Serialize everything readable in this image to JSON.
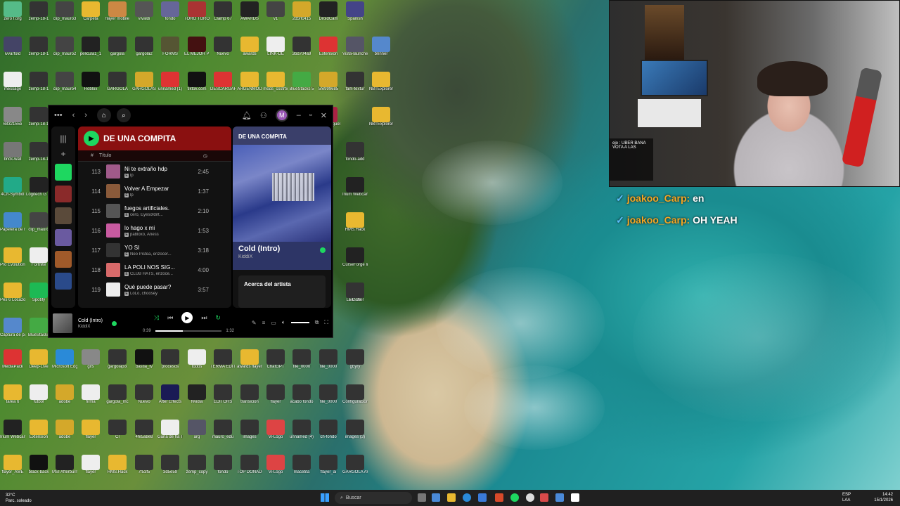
{
  "desktop": {
    "icons": [
      {
        "label": "zero f.org",
        "color": "#5b8"
      },
      {
        "label": "zemp-18-1",
        "color": "#333"
      },
      {
        "label": "clip_mauro3",
        "color": "#444"
      },
      {
        "label": "Carpeta",
        "color": "#e8b830"
      },
      {
        "label": "flayer mobile",
        "color": "#c84"
      },
      {
        "label": "vivaldi",
        "color": "#555"
      },
      {
        "label": "fondo",
        "color": "#669"
      },
      {
        "label": "TORO TORO",
        "color": "#a33"
      },
      {
        "label": "Clamp 67",
        "color": "#333"
      },
      {
        "label": "AWARDS",
        "color": "#222"
      },
      {
        "label": "v1",
        "color": "#444"
      },
      {
        "label": "2d5ffc415",
        "color": "#d4a82a"
      },
      {
        "label": "DroidCam",
        "color": "#222"
      },
      {
        "label": "Spanish",
        "color": "#448"
      },
      {
        "label": "ivvarfold",
        "color": "#446"
      },
      {
        "label": "zemp-18-1",
        "color": "#333"
      },
      {
        "label": "clip_mauro2",
        "color": "#444"
      },
      {
        "label": "pelicula1_1",
        "color": "#222"
      },
      {
        "label": "gargola",
        "color": "#333"
      },
      {
        "label": "gargola2",
        "color": "#333"
      },
      {
        "label": "FORMS",
        "color": "#553"
      },
      {
        "label": "EL MEJOR PHONK",
        "color": "#411"
      },
      {
        "label": "Nuevo",
        "color": "#333"
      },
      {
        "label": "awards",
        "color": "#e8b830"
      },
      {
        "label": "LINK-DE",
        "color": "#eee"
      },
      {
        "label": "3bd704a9",
        "color": "#333"
      },
      {
        "label": "Extension",
        "color": "#d33"
      },
      {
        "label": "Vista-launcher",
        "color": "#556"
      },
      {
        "label": "brinner",
        "color": "#58c"
      },
      {
        "label": "message",
        "color": "#eee"
      },
      {
        "label": "zemp-18-1",
        "color": "#333"
      },
      {
        "label": "clip_mauro4",
        "color": "#444"
      },
      {
        "label": "Roblox",
        "color": "#111"
      },
      {
        "label": "GARGOLA",
        "color": "#333"
      },
      {
        "label": "GARGOLAS",
        "color": "#d4a82a"
      },
      {
        "label": "unnamed (1)",
        "color": "#d33"
      },
      {
        "label": "tiktok.com",
        "color": "#111"
      },
      {
        "label": "DESCARGAR",
        "color": "#d33"
      },
      {
        "label": "ARGENMOD",
        "color": "#e8b830"
      },
      {
        "label": "mods_csstrtx",
        "color": "#e8b830"
      },
      {
        "label": "BlueStacks 5",
        "color": "#4a4"
      },
      {
        "label": "5fe999685",
        "color": "#d4a82a"
      },
      {
        "label": "fam-textur",
        "color": "#333"
      },
      {
        "label": "NBTExplorer",
        "color": "#e8b830"
      },
      {
        "label": "6832155e",
        "color": "#888"
      },
      {
        "label": "zemp-18-1",
        "color": "#333"
      },
      {
        "label": "brick-wall",
        "color": "#777"
      },
      {
        "label": "zemp-18-1",
        "color": "#333"
      },
      {
        "label": "4Ch-Symbol",
        "color": "#2a8"
      },
      {
        "label": "Logitech G HUB",
        "color": "#222"
      },
      {
        "label": "Papelera de reciclaje",
        "color": "#48c"
      },
      {
        "label": "clip_mauro",
        "color": "#444"
      },
      {
        "label": "Pro Evolution Soccer 6",
        "color": "#e8b830"
      },
      {
        "label": "Fortnite",
        "color": "#eee"
      },
      {
        "label": "Pes 6 Locazos",
        "color": "#e8b830"
      },
      {
        "label": "Spotify",
        "color": "#1db954"
      },
      {
        "label": "Captura de pantalla",
        "color": "#58c"
      },
      {
        "label": "BlueStacks",
        "color": "#4a4"
      },
      {
        "label": "flayer miguel",
        "color": "#a24"
      },
      {
        "label": "NBTExplorer",
        "color": "#e8b830"
      },
      {
        "label": "fondo-add",
        "color": "#333"
      },
      {
        "label": "Irium Webcam",
        "color": "#222"
      },
      {
        "label": "HMS.Hack",
        "color": "#e8b830"
      },
      {
        "label": "CurseForge Installer",
        "color": "#222"
      },
      {
        "label": "Launcher",
        "color": "#333"
      },
      {
        "label": "FC 26",
        "color": "#333"
      },
      {
        "label": "MediaPack",
        "color": "#d33"
      },
      {
        "label": "Deep-Live",
        "color": "#e8b830"
      },
      {
        "label": "Microsoft Edge",
        "color": "#2a8ad8"
      },
      {
        "label": "gifs",
        "color": "#888"
      },
      {
        "label": "gargolapix",
        "color": "#333"
      },
      {
        "label": "bastia_tv",
        "color": "#111"
      },
      {
        "label": "procesos",
        "color": "#333"
      },
      {
        "label": "todos",
        "color": "#eee"
      },
      {
        "label": "TERMA EDITOR",
        "color": "#333"
      },
      {
        "label": "awards flayer",
        "color": "#e8b830"
      },
      {
        "label": "ChatGPT",
        "color": "#333"
      },
      {
        "label": "file_0000",
        "color": "#333"
      },
      {
        "label": "file_0000",
        "color": "#333"
      },
      {
        "label": "gbyry",
        "color": "#333"
      },
      {
        "label": "tarea 6",
        "color": "#e8b830"
      },
      {
        "label": "futbol",
        "color": "#eee"
      },
      {
        "label": "adobe",
        "color": "#d4a82a"
      },
      {
        "label": "firma",
        "color": "#eee"
      },
      {
        "label": "gargola_mc",
        "color": "#333"
      },
      {
        "label": "Nuevo",
        "color": "#333"
      },
      {
        "label": "After Effects",
        "color": "#1a1a55"
      },
      {
        "label": "Nvidia",
        "color": "#222"
      },
      {
        "label": "EDITORS",
        "color": "#333"
      },
      {
        "label": "transicion",
        "color": "#333"
      },
      {
        "label": "flayer",
        "color": "#333"
      },
      {
        "label": "acabo fondo",
        "color": "#333"
      },
      {
        "label": "file_0000",
        "color": "#333"
      },
      {
        "label": "Configuracion",
        "color": "#333"
      },
      {
        "label": "Irium Webcam",
        "color": "#222"
      },
      {
        "label": "Extension",
        "color": "#e8b830"
      },
      {
        "label": "adobe",
        "color": "#d4a82a"
      },
      {
        "label": "flayer",
        "color": "#e8b830"
      },
      {
        "label": "CI",
        "color": "#333"
      },
      {
        "label": "4fe5a8e8",
        "color": "#333"
      },
      {
        "label": "Gana de ha Touch",
        "color": "#eee"
      },
      {
        "label": "arg",
        "color": "#556"
      },
      {
        "label": "mauro_edu",
        "color": "#333"
      },
      {
        "label": "images",
        "color": "#333"
      },
      {
        "label": "Vi-Logo",
        "color": "#d44"
      },
      {
        "label": "unnamed (4)",
        "color": "#333"
      },
      {
        "label": "ch-fondo",
        "color": "#333"
      },
      {
        "label": "images (3)",
        "color": "#333"
      },
      {
        "label": "flayer_AME",
        "color": "#e8b830"
      },
      {
        "label": "black-back",
        "color": "#111"
      },
      {
        "label": "MSI Afterburner",
        "color": "#222"
      },
      {
        "label": "flayer",
        "color": "#eee"
      },
      {
        "label": "HMS.Hack",
        "color": "#e8b830"
      },
      {
        "label": "7f53f5",
        "color": "#333"
      },
      {
        "label": "3d5e59",
        "color": "#333"
      },
      {
        "label": "zemp_copy",
        "color": "#333"
      },
      {
        "label": "fondo",
        "color": "#333"
      },
      {
        "label": "TOP DONADOR",
        "color": "#333"
      },
      {
        "label": "Vi-Logo",
        "color": "#d44"
      },
      {
        "label": "macetita",
        "color": "#333"
      },
      {
        "label": "flayer_ai",
        "color": "#333"
      },
      {
        "label": "GARGOLA AWARDS",
        "color": "#333"
      }
    ]
  },
  "spotify": {
    "playlist_title": "DE UNA COMPITA",
    "column_title": "Título",
    "tracks": [
      {
        "num": "113",
        "name": "Ni te extraño hdp",
        "artist": "lp",
        "duration": "2:45",
        "art": "#a05a8a"
      },
      {
        "num": "114",
        "name": "Volver A Empezar",
        "artist": "lp",
        "duration": "1:37",
        "art": "#8a5a3a"
      },
      {
        "num": "115",
        "name": "fuegos artificiales.",
        "artist": "cero, Eyesofdirt...",
        "duration": "2:10",
        "art": "#555"
      },
      {
        "num": "116",
        "name": "lo hago x mi",
        "artist": "pabloxo, Ariess",
        "duration": "1:53",
        "art": "#c85aa0"
      },
      {
        "num": "117",
        "name": "YO SI",
        "artist": "Neo Pistea, enzocer...",
        "duration": "3:18",
        "art": "#333"
      },
      {
        "num": "118",
        "name": "LA POLI NOS SIG...",
        "artist": "CLUB HATS, enzoce...",
        "duration": "4:00",
        "art": "#d86a6a"
      },
      {
        "num": "119",
        "name": "Qué puede pasar?",
        "artist": "LoLo, choosey",
        "duration": "3:57",
        "art": "#eee"
      }
    ],
    "right_panel_title": "DE UNA COMPITA",
    "now_song": "Cold (Intro)",
    "now_artist": "KiddiX",
    "about_label": "Acerca del artista",
    "bar": {
      "song": "Cold (Intro)",
      "artist": "KiddiX",
      "elapsed": "0:39",
      "total": "1:32",
      "progress_fraction": 0.42
    }
  },
  "webcam": {
    "chat_line1": "ejo : UBER BANA",
    "chat_line2": "VOTA A LAS"
  },
  "chat": [
    {
      "user": "joakoo_Carp:",
      "message": "en"
    },
    {
      "user": "joakoo_Carp:",
      "message": "OH YEAH"
    }
  ],
  "taskbar": {
    "temp": "32°C",
    "weather": "Parc. soleado",
    "search_placeholder": "Buscar",
    "lang1": "ESP",
    "lang2": "LAA",
    "time": "14:42",
    "date": "15/1/2026"
  }
}
